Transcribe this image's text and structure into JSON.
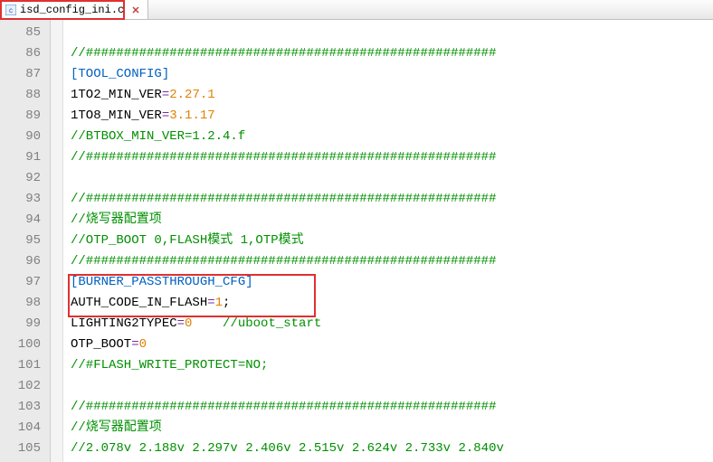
{
  "tab": {
    "filename": "isd_config_ini.c"
  },
  "lines": [
    {
      "n": 85,
      "segs": []
    },
    {
      "n": 86,
      "segs": [
        {
          "t": "//######################################################",
          "c": "c-comment"
        }
      ]
    },
    {
      "n": 87,
      "segs": [
        {
          "t": "[TOOL_CONFIG]",
          "c": "c-blue"
        }
      ]
    },
    {
      "n": 88,
      "segs": [
        {
          "t": "1TO2_MIN_VER",
          "c": "c-key"
        },
        {
          "t": "=",
          "c": "c-eq"
        },
        {
          "t": "2.27.1",
          "c": "c-val-orange"
        }
      ]
    },
    {
      "n": 89,
      "segs": [
        {
          "t": "1TO8_MIN_VER",
          "c": "c-key"
        },
        {
          "t": "=",
          "c": "c-eq"
        },
        {
          "t": "3.1.17",
          "c": "c-val-orange"
        }
      ]
    },
    {
      "n": 90,
      "segs": [
        {
          "t": "//BTBOX_MIN_VER=1.2.4.f",
          "c": "c-comment"
        }
      ]
    },
    {
      "n": 91,
      "segs": [
        {
          "t": "//######################################################",
          "c": "c-comment"
        }
      ]
    },
    {
      "n": 92,
      "segs": []
    },
    {
      "n": 93,
      "segs": [
        {
          "t": "//######################################################",
          "c": "c-comment"
        }
      ]
    },
    {
      "n": 94,
      "segs": [
        {
          "t": "//烧写器配置项",
          "c": "c-comment"
        }
      ]
    },
    {
      "n": 95,
      "segs": [
        {
          "t": "//OTP_BOOT 0,FLASH模式 1,OTP模式",
          "c": "c-comment"
        }
      ]
    },
    {
      "n": 96,
      "segs": [
        {
          "t": "//######################################################",
          "c": "c-comment"
        }
      ]
    },
    {
      "n": 97,
      "segs": [
        {
          "t": "[BURNER_PASSTHROUGH_CFG]",
          "c": "c-blue"
        }
      ]
    },
    {
      "n": 98,
      "segs": [
        {
          "t": "AUTH_CODE_IN_FLASH",
          "c": "c-key"
        },
        {
          "t": "=",
          "c": "c-eq"
        },
        {
          "t": "1",
          "c": "c-orange"
        },
        {
          "t": ";",
          "c": "c-key"
        }
      ]
    },
    {
      "n": 99,
      "segs": [
        {
          "t": "LIGHTING2TYPEC",
          "c": "c-key"
        },
        {
          "t": "=",
          "c": "c-eq"
        },
        {
          "t": "0",
          "c": "c-orange"
        },
        {
          "t": "    ",
          "c": ""
        },
        {
          "t": "//uboot_start",
          "c": "c-comment"
        }
      ]
    },
    {
      "n": 100,
      "segs": [
        {
          "t": "OTP_BOOT",
          "c": "c-key"
        },
        {
          "t": "=",
          "c": "c-eq"
        },
        {
          "t": "0",
          "c": "c-orange"
        }
      ]
    },
    {
      "n": 101,
      "segs": [
        {
          "t": "//#FLASH_WRITE_PROTECT=NO;",
          "c": "c-comment"
        }
      ]
    },
    {
      "n": 102,
      "segs": []
    },
    {
      "n": 103,
      "segs": [
        {
          "t": "//######################################################",
          "c": "c-comment"
        }
      ]
    },
    {
      "n": 104,
      "segs": [
        {
          "t": "//烧写器配置项",
          "c": "c-comment"
        }
      ]
    },
    {
      "n": 105,
      "segs": [
        {
          "t": "//2.078v 2.188v 2.297v 2.406v 2.515v 2.624v 2.733v 2.840v",
          "c": "c-comment"
        }
      ]
    }
  ]
}
